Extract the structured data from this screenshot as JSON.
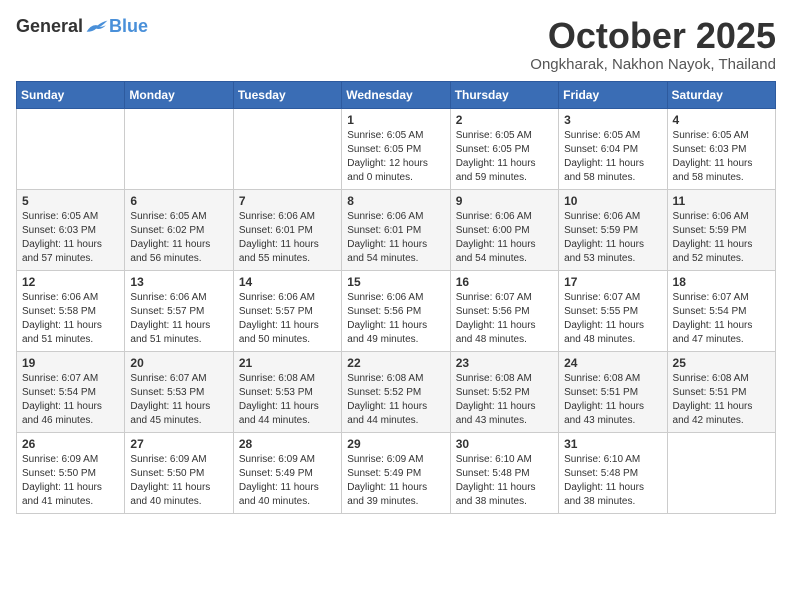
{
  "logo": {
    "general": "General",
    "blue": "Blue"
  },
  "title": "October 2025",
  "location": "Ongkharak, Nakhon Nayok, Thailand",
  "weekdays": [
    "Sunday",
    "Monday",
    "Tuesday",
    "Wednesday",
    "Thursday",
    "Friday",
    "Saturday"
  ],
  "weeks": [
    [
      {
        "day": "",
        "info": ""
      },
      {
        "day": "",
        "info": ""
      },
      {
        "day": "",
        "info": ""
      },
      {
        "day": "1",
        "info": "Sunrise: 6:05 AM\nSunset: 6:05 PM\nDaylight: 12 hours and 0 minutes."
      },
      {
        "day": "2",
        "info": "Sunrise: 6:05 AM\nSunset: 6:05 PM\nDaylight: 11 hours and 59 minutes."
      },
      {
        "day": "3",
        "info": "Sunrise: 6:05 AM\nSunset: 6:04 PM\nDaylight: 11 hours and 58 minutes."
      },
      {
        "day": "4",
        "info": "Sunrise: 6:05 AM\nSunset: 6:03 PM\nDaylight: 11 hours and 58 minutes."
      }
    ],
    [
      {
        "day": "5",
        "info": "Sunrise: 6:05 AM\nSunset: 6:03 PM\nDaylight: 11 hours and 57 minutes."
      },
      {
        "day": "6",
        "info": "Sunrise: 6:05 AM\nSunset: 6:02 PM\nDaylight: 11 hours and 56 minutes."
      },
      {
        "day": "7",
        "info": "Sunrise: 6:06 AM\nSunset: 6:01 PM\nDaylight: 11 hours and 55 minutes."
      },
      {
        "day": "8",
        "info": "Sunrise: 6:06 AM\nSunset: 6:01 PM\nDaylight: 11 hours and 54 minutes."
      },
      {
        "day": "9",
        "info": "Sunrise: 6:06 AM\nSunset: 6:00 PM\nDaylight: 11 hours and 54 minutes."
      },
      {
        "day": "10",
        "info": "Sunrise: 6:06 AM\nSunset: 5:59 PM\nDaylight: 11 hours and 53 minutes."
      },
      {
        "day": "11",
        "info": "Sunrise: 6:06 AM\nSunset: 5:59 PM\nDaylight: 11 hours and 52 minutes."
      }
    ],
    [
      {
        "day": "12",
        "info": "Sunrise: 6:06 AM\nSunset: 5:58 PM\nDaylight: 11 hours and 51 minutes."
      },
      {
        "day": "13",
        "info": "Sunrise: 6:06 AM\nSunset: 5:57 PM\nDaylight: 11 hours and 51 minutes."
      },
      {
        "day": "14",
        "info": "Sunrise: 6:06 AM\nSunset: 5:57 PM\nDaylight: 11 hours and 50 minutes."
      },
      {
        "day": "15",
        "info": "Sunrise: 6:06 AM\nSunset: 5:56 PM\nDaylight: 11 hours and 49 minutes."
      },
      {
        "day": "16",
        "info": "Sunrise: 6:07 AM\nSunset: 5:56 PM\nDaylight: 11 hours and 48 minutes."
      },
      {
        "day": "17",
        "info": "Sunrise: 6:07 AM\nSunset: 5:55 PM\nDaylight: 11 hours and 48 minutes."
      },
      {
        "day": "18",
        "info": "Sunrise: 6:07 AM\nSunset: 5:54 PM\nDaylight: 11 hours and 47 minutes."
      }
    ],
    [
      {
        "day": "19",
        "info": "Sunrise: 6:07 AM\nSunset: 5:54 PM\nDaylight: 11 hours and 46 minutes."
      },
      {
        "day": "20",
        "info": "Sunrise: 6:07 AM\nSunset: 5:53 PM\nDaylight: 11 hours and 45 minutes."
      },
      {
        "day": "21",
        "info": "Sunrise: 6:08 AM\nSunset: 5:53 PM\nDaylight: 11 hours and 44 minutes."
      },
      {
        "day": "22",
        "info": "Sunrise: 6:08 AM\nSunset: 5:52 PM\nDaylight: 11 hours and 44 minutes."
      },
      {
        "day": "23",
        "info": "Sunrise: 6:08 AM\nSunset: 5:52 PM\nDaylight: 11 hours and 43 minutes."
      },
      {
        "day": "24",
        "info": "Sunrise: 6:08 AM\nSunset: 5:51 PM\nDaylight: 11 hours and 43 minutes."
      },
      {
        "day": "25",
        "info": "Sunrise: 6:08 AM\nSunset: 5:51 PM\nDaylight: 11 hours and 42 minutes."
      }
    ],
    [
      {
        "day": "26",
        "info": "Sunrise: 6:09 AM\nSunset: 5:50 PM\nDaylight: 11 hours and 41 minutes."
      },
      {
        "day": "27",
        "info": "Sunrise: 6:09 AM\nSunset: 5:50 PM\nDaylight: 11 hours and 40 minutes."
      },
      {
        "day": "28",
        "info": "Sunrise: 6:09 AM\nSunset: 5:49 PM\nDaylight: 11 hours and 40 minutes."
      },
      {
        "day": "29",
        "info": "Sunrise: 6:09 AM\nSunset: 5:49 PM\nDaylight: 11 hours and 39 minutes."
      },
      {
        "day": "30",
        "info": "Sunrise: 6:10 AM\nSunset: 5:48 PM\nDaylight: 11 hours and 38 minutes."
      },
      {
        "day": "31",
        "info": "Sunrise: 6:10 AM\nSunset: 5:48 PM\nDaylight: 11 hours and 38 minutes."
      },
      {
        "day": "",
        "info": ""
      }
    ]
  ]
}
